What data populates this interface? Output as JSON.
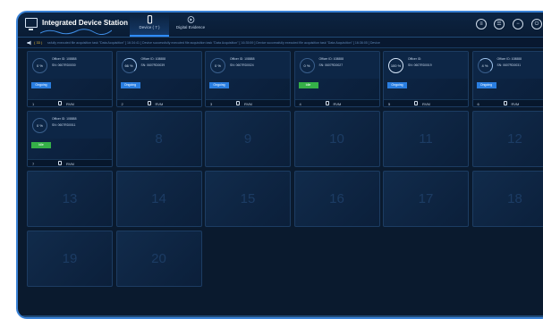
{
  "app": {
    "title": "Integrated Device Station",
    "tabs": [
      {
        "label": "Device ( 7 )",
        "icon": "phone-icon",
        "active": true
      },
      {
        "label": "Digital Evidence",
        "icon": "evidence-icon",
        "active": false
      }
    ],
    "tools": [
      "list-icon",
      "menu-icon",
      "minimize-icon",
      "power-icon"
    ]
  },
  "log": {
    "count": "( 33 )",
    "text": "ssfully executed file acquisition task \"Data Acquisition\"       [ 16:34:41 ] Device successfully executed file acquisition task \"Data Acquisition\"       [ 16:35:59 ] Device successfully executed file acquisition task \"Data Acquisition\"       [ 16:36:05 ] Device"
  },
  "devices": [
    {
      "slot": "1",
      "progress": "0 %",
      "progress_value": 0,
      "officer": "Officer ID: 108888",
      "sn": "SN: 0607RD0030",
      "status": "Ongoing",
      "status_type": "ongoing",
      "device": "RVM"
    },
    {
      "slot": "2",
      "progress": "66 %",
      "progress_value": 66,
      "officer": "Officer ID: 108888",
      "sn": "SN: 0607RD0039",
      "status": "Ongoing",
      "status_type": "ongoing",
      "device": "RVM"
    },
    {
      "slot": "3",
      "progress": "0 %",
      "progress_value": 0,
      "officer": "Officer ID: 108888",
      "sn": "SN: 0607RD0024",
      "status": "Ongoing",
      "status_type": "ongoing",
      "device": "RVM"
    },
    {
      "slot": "4",
      "progress": "0 %",
      "progress_value": 0,
      "officer": "Officer ID: 108888",
      "sn": "SN: 0607RD0027",
      "status": "Idle",
      "status_type": "idle",
      "device": "RVM"
    },
    {
      "slot": "5",
      "progress": "100 %",
      "progress_value": 100,
      "officer": "Officer ID:",
      "sn": "SN: 0607RD0019",
      "status": "Ongoing",
      "status_type": "ongoing",
      "device": "RVM"
    },
    {
      "slot": "6",
      "progress": "4 %",
      "progress_value": 4,
      "officer": "Officer ID: 108888",
      "sn": "SN: 0607RD0031",
      "status": "Ongoing",
      "status_type": "ongoing",
      "device": "RVM"
    },
    {
      "slot": "7",
      "progress": "0 %",
      "progress_value": 0,
      "officer": "Officer ID: 108888",
      "sn": "SN: 0607RD0011",
      "status": "Idle",
      "status_type": "idle",
      "device": "RVM"
    }
  ],
  "empty_slots": [
    "8",
    "9",
    "10",
    "11",
    "12",
    "13",
    "14",
    "15",
    "16",
    "17",
    "18",
    "19",
    "20"
  ]
}
